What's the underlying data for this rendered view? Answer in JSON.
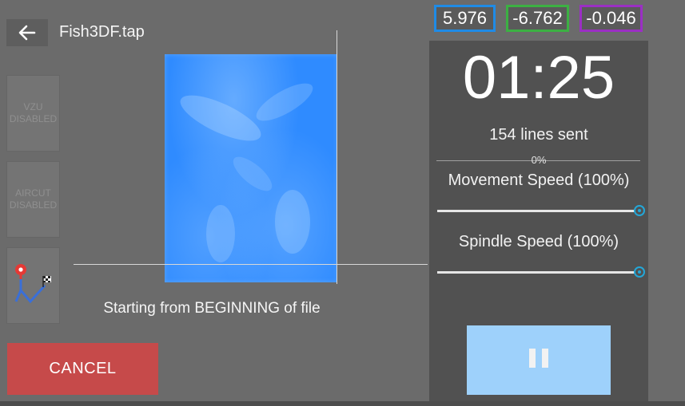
{
  "header": {
    "back_icon": "arrow-left-icon",
    "title": "Fish3DF.tap"
  },
  "sidebar": {
    "vzu_label": "VZU\nDISABLED",
    "aircut_label": "AIRCUT\nDISABLED",
    "route_icon": "route-map-pin-icon"
  },
  "cancel": {
    "label": "CANCEL",
    "color": "#c64a4a"
  },
  "preview": {
    "status": "Starting from BEGINNING of file"
  },
  "coordinates": {
    "x": {
      "value": "5.976",
      "color": "#1f8be6"
    },
    "y": {
      "value": "-6.762",
      "color": "#3cb043"
    },
    "z": {
      "value": "-0.046",
      "color": "#9b2fc4"
    }
  },
  "job": {
    "timer": "01:25",
    "lines_sent": "154 lines sent",
    "progress_label": "0%",
    "progress": 0
  },
  "sliders": {
    "movement": {
      "label": "Movement Speed (100%)",
      "value_percent": 100
    },
    "spindle": {
      "label": "Spindle Speed (100%)",
      "value_percent": 100
    },
    "accent": "#23a7d8"
  },
  "pause": {
    "icon": "pause-icon",
    "color": "#9ed1fb"
  }
}
